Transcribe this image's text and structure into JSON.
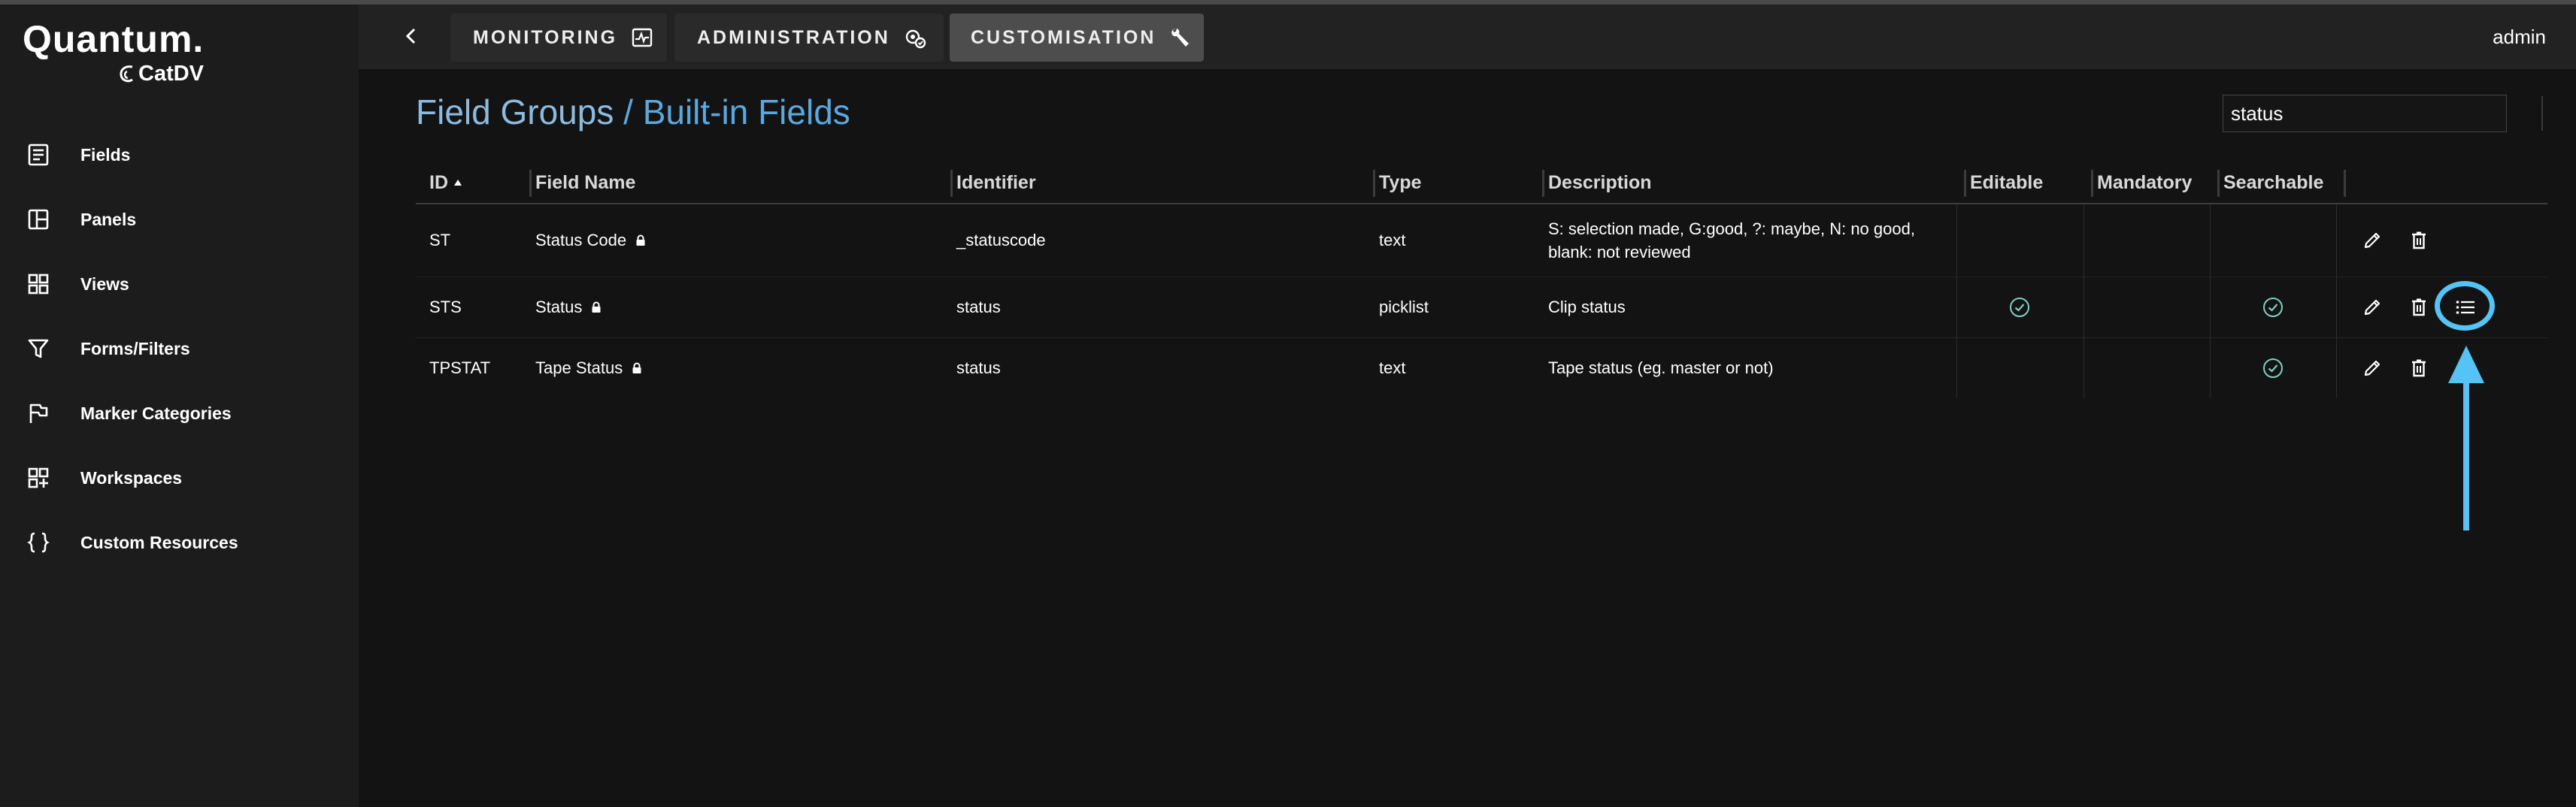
{
  "brand": {
    "name": "Quantum.",
    "product": "CatDV"
  },
  "sidebar": {
    "items": [
      {
        "label": "Fields",
        "icon": "document-list-icon"
      },
      {
        "label": "Panels",
        "icon": "panel-layout-icon"
      },
      {
        "label": "Views",
        "icon": "grid-icon"
      },
      {
        "label": "Forms/Filters",
        "icon": "filter-icon"
      },
      {
        "label": "Marker Categories",
        "icon": "flag-icon"
      },
      {
        "label": "Workspaces",
        "icon": "add-grid-icon"
      },
      {
        "label": "Custom Resources",
        "icon": "braces-icon"
      }
    ]
  },
  "topbar": {
    "tabs": [
      {
        "label": "MONITORING",
        "icon": "monitoring-icon"
      },
      {
        "label": "ADMINISTRATION",
        "icon": "admin-gear-icon"
      },
      {
        "label": "CUSTOMISATION",
        "icon": "wrench-icon",
        "active": true
      }
    ],
    "user": "admin"
  },
  "page": {
    "breadcrumb_parent": "Field Groups",
    "separator": "/",
    "breadcrumb_current": "Built-in Fields",
    "search_value": "status"
  },
  "table": {
    "columns": [
      "ID",
      "Field Name",
      "Identifier",
      "Type",
      "Description",
      "Editable",
      "Mandatory",
      "Searchable"
    ],
    "sort": {
      "column": "ID",
      "direction": "ascending"
    },
    "rows": [
      {
        "id": "ST",
        "field_name": "Status Code",
        "identifier": "_statuscode",
        "type": "text",
        "description": "S: selection made, G:good, ?: maybe, N: no good, blank: not reviewed",
        "editable": false,
        "mandatory": false,
        "searchable": false,
        "locked": true,
        "has_picklist": false
      },
      {
        "id": "STS",
        "field_name": "Status",
        "identifier": "status",
        "type": "picklist",
        "description": "Clip status",
        "editable": true,
        "mandatory": false,
        "searchable": true,
        "locked": true,
        "has_picklist": true
      },
      {
        "id": "TPSTAT",
        "field_name": "Tape Status",
        "identifier": "status",
        "type": "text",
        "description": "Tape status (eg. master or not)",
        "editable": false,
        "mandatory": false,
        "searchable": true,
        "locked": true,
        "has_picklist": false
      }
    ]
  },
  "colors": {
    "accent": "#5aa8e0",
    "annotation": "#55c3f3",
    "check": "#7fd0c2"
  }
}
